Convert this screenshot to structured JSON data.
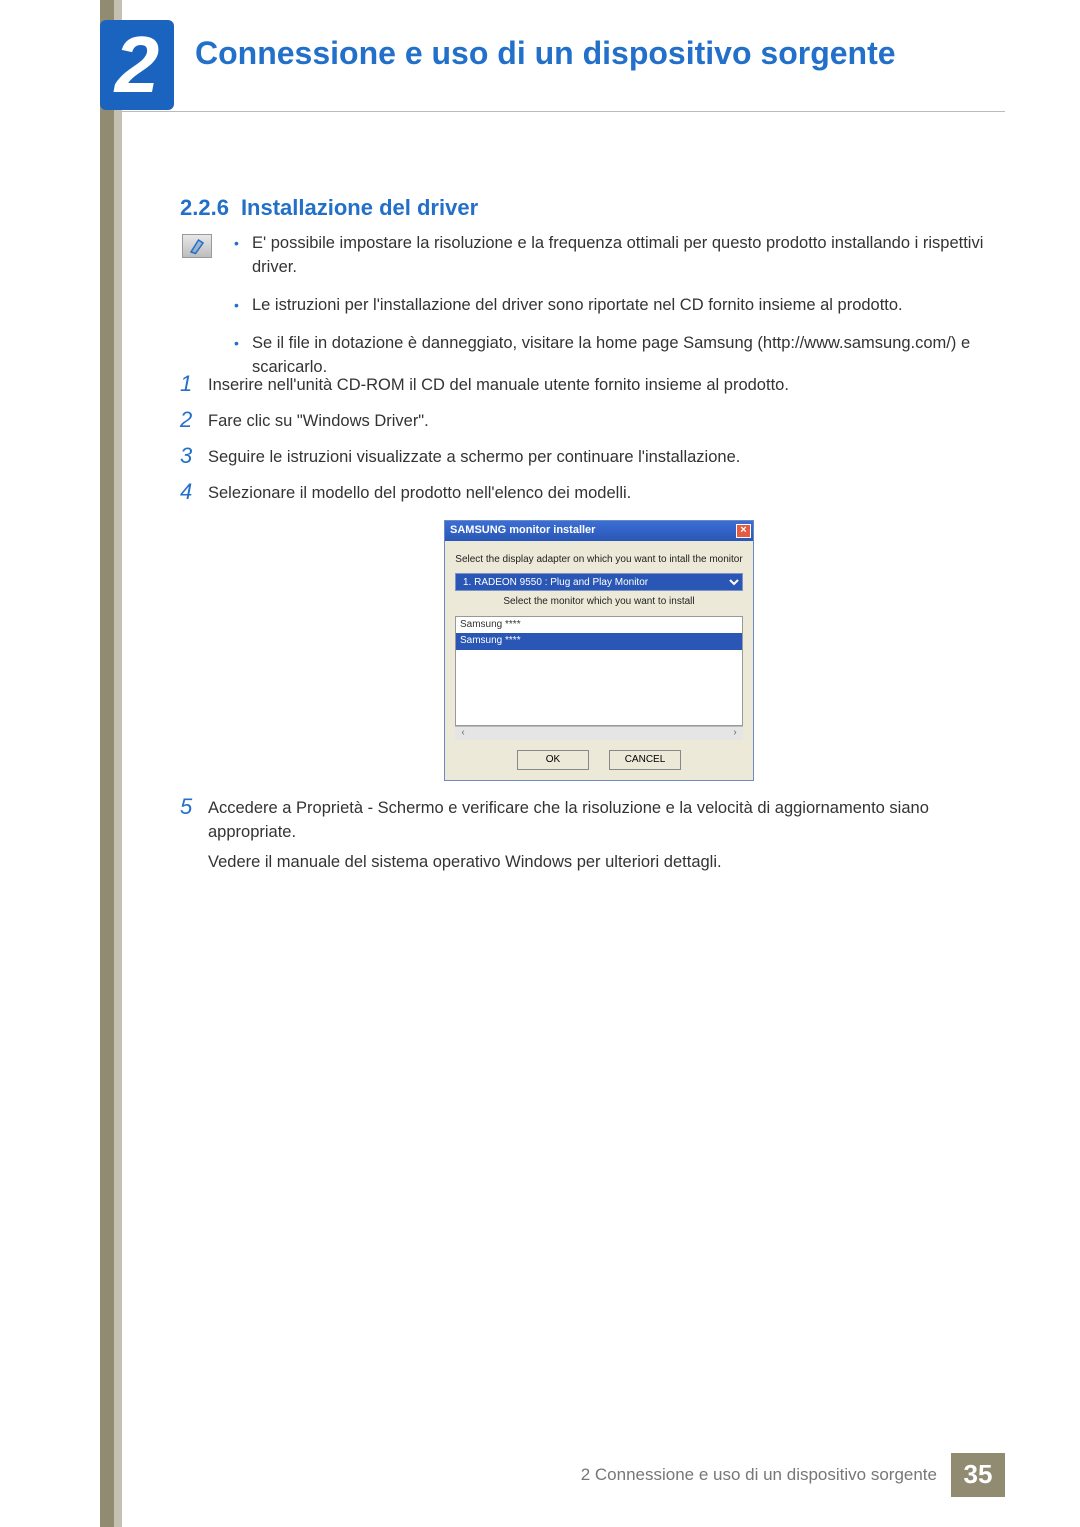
{
  "chapter": {
    "number": "2",
    "title": "Connessione e uso di un dispositivo sorgente"
  },
  "section": {
    "number": "2.2.6",
    "title": "Installazione del driver"
  },
  "notes": [
    "E' possibile impostare la risoluzione e la frequenza ottimali per questo prodotto installando i rispettivi driver.",
    "Le istruzioni per l'installazione del driver sono riportate nel CD fornito insieme al prodotto.",
    "Se il file in dotazione è danneggiato, visitare la home page Samsung (http://www.samsung.com/) e scaricarlo."
  ],
  "steps": {
    "s1": {
      "n": "1",
      "t": "Inserire nell'unità CD-ROM il CD del manuale utente fornito insieme al prodotto."
    },
    "s2": {
      "n": "2",
      "t": "Fare clic su \"Windows Driver\"."
    },
    "s3": {
      "n": "3",
      "t": "Seguire le istruzioni visualizzate a schermo per continuare l'installazione."
    },
    "s4": {
      "n": "4",
      "t": "Selezionare il modello del prodotto nell'elenco dei modelli."
    },
    "s5": {
      "n": "5",
      "t": "Accedere a Proprietà - Schermo e verificare che la risoluzione e la velocità di aggiornamento siano appropriate."
    },
    "s5_extra": "Vedere il manuale del sistema operativo Windows per ulteriori dettagli."
  },
  "installer": {
    "title": "SAMSUNG monitor installer",
    "label1": "Select the display adapter on which you want to intall the monitor",
    "adapter": "1. RADEON 9550 : Plug and Play Monitor",
    "label2": "Select the monitor which you want to install",
    "list": [
      "Samsung ****",
      "Samsung ****"
    ],
    "ok": "OK",
    "cancel": "CANCEL"
  },
  "footer": {
    "text": "2 Connessione e uso di un dispositivo sorgente",
    "page": "35"
  }
}
